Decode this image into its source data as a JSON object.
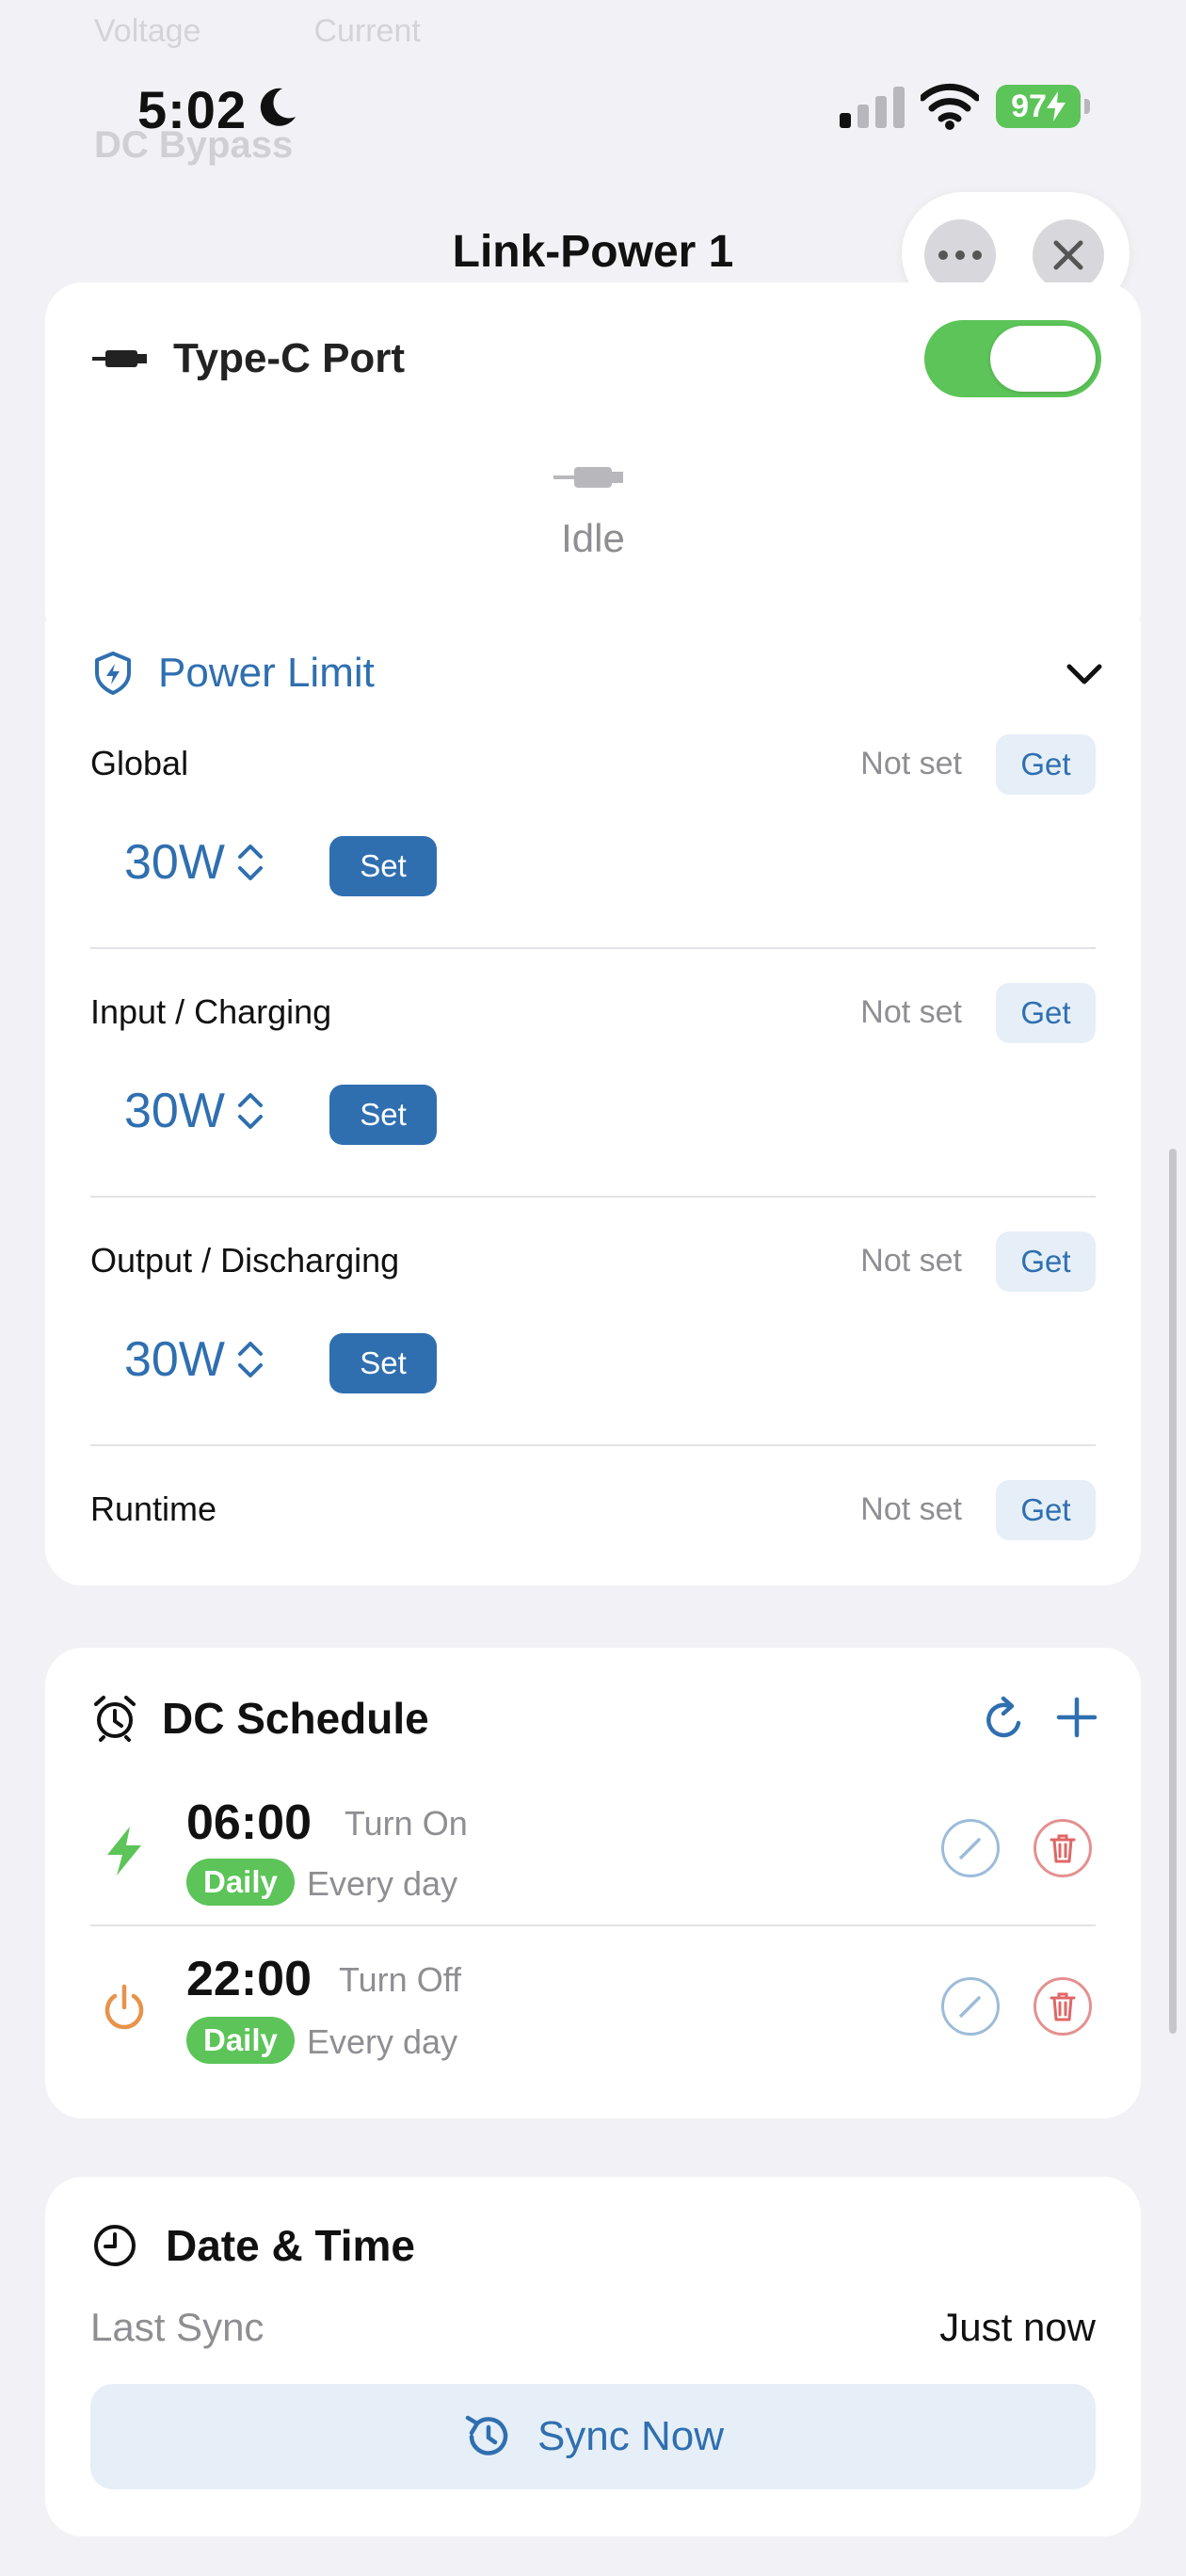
{
  "status_bar": {
    "time": "5:02",
    "battery": "97"
  },
  "background_ghost": {
    "tab_1": "Voltage",
    "tab_2": "Current",
    "row": "DC Bypass"
  },
  "header": {
    "title": "Link-Power 1"
  },
  "type_c": {
    "title": "Type-C Port",
    "enabled": true,
    "state": "Idle"
  },
  "power_limit": {
    "title": "Power Limit",
    "rows": [
      {
        "label": "Global",
        "status": "Not set",
        "get": "Get",
        "value": "30W",
        "set": "Set"
      },
      {
        "label": "Input / Charging",
        "status": "Not set",
        "get": "Get",
        "value": "30W",
        "set": "Set"
      },
      {
        "label": "Output / Discharging",
        "status": "Not set",
        "get": "Get",
        "value": "30W",
        "set": "Set"
      },
      {
        "label": "Runtime",
        "status": "Not set",
        "get": "Get"
      }
    ]
  },
  "schedule": {
    "title": "DC Schedule",
    "items": [
      {
        "time": "06:00",
        "action": "Turn On",
        "badge": "Daily",
        "repeat": "Every day",
        "icon": "bolt-icon"
      },
      {
        "time": "22:00",
        "action": "Turn Off",
        "badge": "Daily",
        "repeat": "Every day",
        "icon": "power-icon"
      }
    ]
  },
  "date_time": {
    "title": "Date & Time",
    "last_sync_label": "Last Sync",
    "last_sync_value": "Just now",
    "sync_button": "Sync Now"
  },
  "colors": {
    "accent": "#2f6fb0",
    "green": "#5cc458",
    "danger": "#e06666",
    "orange": "#e8934a"
  }
}
